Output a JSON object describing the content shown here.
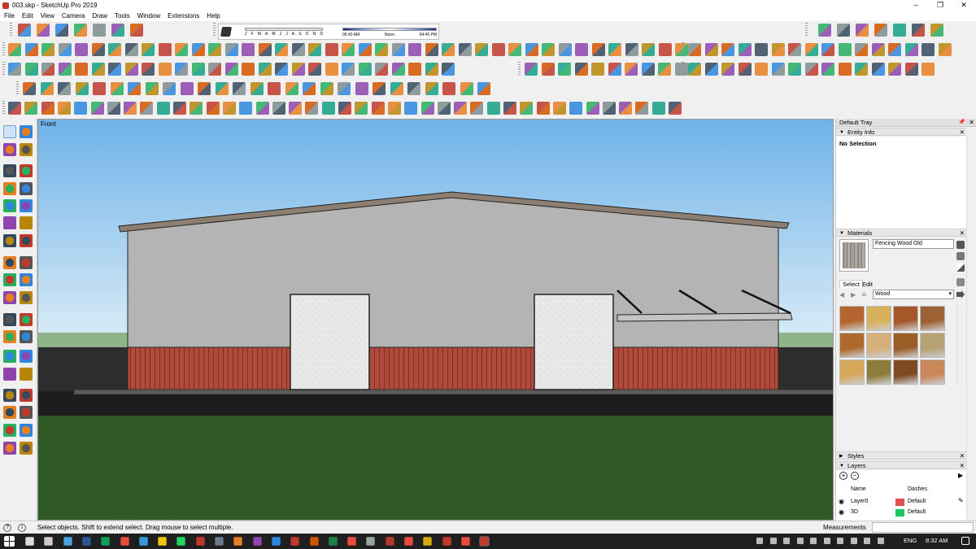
{
  "window": {
    "title": "003.skp - SketchUp Pro 2019",
    "minimize_glyph": "–",
    "maximize_glyph": "❐",
    "close_glyph": "✕"
  },
  "menu": [
    "File",
    "Edit",
    "View",
    "Camera",
    "Draw",
    "Tools",
    "Window",
    "Extensions",
    "Help"
  ],
  "shadows": {
    "months": [
      "J",
      "F",
      "M",
      "A",
      "M",
      "J",
      "J",
      "A",
      "S",
      "O",
      "N",
      "D"
    ],
    "time_start": "06:43 AM",
    "time_mid": "Noon",
    "time_end": "04:45 PM"
  },
  "viewport": {
    "scene_label": "Front"
  },
  "tray": {
    "title": "Default Tray",
    "entity_info": {
      "header": "Entity Info",
      "selection": "No Selection"
    },
    "materials": {
      "header": "Materials",
      "material_name": "Fencing Wood Old",
      "tab_select": "Select",
      "tab_edit": "Edit",
      "library": "Wood",
      "swatch_colors": [
        "#b5652d",
        "#d8b25a",
        "#a4582a",
        "#9c6233",
        "#ad6a2c",
        "#d6b07a",
        "#9a5d26",
        "#b7a273",
        "#d6a85a",
        "#8c7d3a",
        "#7e4a22",
        "#c98658"
      ]
    },
    "styles": {
      "header": "Styles"
    },
    "layers": {
      "header": "Layers",
      "col_name": "Name",
      "col_dashes": "Dashes",
      "rows": [
        {
          "name": "Layer0",
          "dashes": "Default",
          "color": "#e05050"
        },
        {
          "name": "3D",
          "dashes": "Default",
          "color": "#22c55e"
        }
      ]
    }
  },
  "status": {
    "message": "Select objects. Shift to extend select. Drag mouse to select multiple.",
    "measurements_label": "Measurements"
  },
  "taskbar": {
    "language": "ENG",
    "time": "8:32 AM"
  },
  "colors": {
    "sky_top": "#72b4e8",
    "sky_bottom": "#cfe6f4",
    "grass": "#2f5a25",
    "wall": "#b4b4b4",
    "wainscot": "#b04a3c",
    "door": "#e6e6e6",
    "accent": "#c0392b"
  }
}
